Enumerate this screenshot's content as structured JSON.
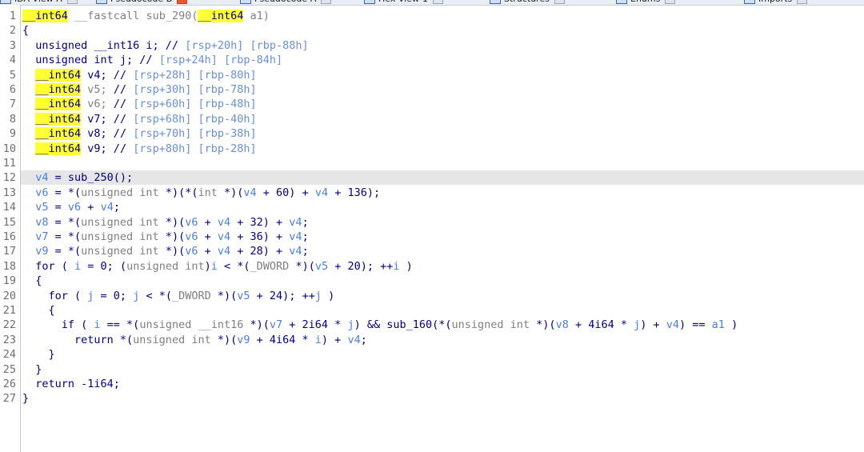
{
  "tabs": [
    {
      "label": "IDA View-A",
      "active": false
    },
    {
      "label": "Pseudocode-B",
      "active": true
    },
    {
      "label": "Pseudocode-A",
      "active": false
    },
    {
      "label": "Hex View-1",
      "active": false
    },
    {
      "label": "Structures",
      "active": false
    },
    {
      "label": "Enums",
      "active": false
    },
    {
      "label": "Imports",
      "active": false
    }
  ],
  "highlight_line": 12,
  "highlight_color": "#ffff33",
  "lines": [
    {
      "no": "1",
      "tokens": [
        [
          "h",
          "__int64"
        ],
        [
          "g",
          " __fastcall sub_290("
        ],
        [
          "h",
          "__int64"
        ],
        [
          "g",
          " a1)"
        ]
      ]
    },
    {
      "no": "2",
      "tokens": [
        [
          "n",
          "{"
        ]
      ]
    },
    {
      "no": "3",
      "tokens": [
        [
          "n",
          "  unsigned __int16 i; // "
        ],
        [
          "cv",
          "[rsp+20h] [rbp-88h]"
        ]
      ]
    },
    {
      "no": "4",
      "tokens": [
        [
          "n",
          "  unsigned int j; // "
        ],
        [
          "cv",
          "[rsp+24h] [rbp-84h]"
        ]
      ]
    },
    {
      "no": "5",
      "tokens": [
        [
          "n",
          "  "
        ],
        [
          "h",
          "__int64"
        ],
        [
          "n",
          " v4; // "
        ],
        [
          "cv",
          "[rsp+28h] [rbp-80h]"
        ]
      ]
    },
    {
      "no": "6",
      "tokens": [
        [
          "n",
          "  "
        ],
        [
          "h",
          "__int64"
        ],
        [
          "g",
          " v5; "
        ],
        [
          "n",
          "// "
        ],
        [
          "cv",
          "[rsp+30h] [rbp-78h]"
        ]
      ]
    },
    {
      "no": "7",
      "tokens": [
        [
          "n",
          "  "
        ],
        [
          "h",
          "__int64"
        ],
        [
          "g",
          " v6; "
        ],
        [
          "n",
          "// "
        ],
        [
          "cv",
          "[rsp+60h] [rbp-48h]"
        ]
      ]
    },
    {
      "no": "8",
      "tokens": [
        [
          "n",
          "  "
        ],
        [
          "h",
          "__int64"
        ],
        [
          "n",
          " v7; // "
        ],
        [
          "cv",
          "[rsp+68h] [rbp-40h]"
        ]
      ]
    },
    {
      "no": "9",
      "tokens": [
        [
          "n",
          "  "
        ],
        [
          "h",
          "__int64"
        ],
        [
          "n",
          " v8; // "
        ],
        [
          "cv",
          "[rsp+70h] [rbp-38h]"
        ]
      ]
    },
    {
      "no": "10",
      "tokens": [
        [
          "n",
          "  "
        ],
        [
          "h",
          "__int64"
        ],
        [
          "n",
          " v9; // "
        ],
        [
          "cv",
          "[rsp+80h] [rbp-28h]"
        ]
      ]
    },
    {
      "no": "11",
      "tokens": []
    },
    {
      "no": "12",
      "tokens": [
        [
          "v",
          "  v4"
        ],
        [
          "n",
          " = sub_250();"
        ]
      ]
    },
    {
      "no": "13",
      "tokens": [
        [
          "v",
          "  v6"
        ],
        [
          "n",
          " = *("
        ],
        [
          "g",
          "unsigned int"
        ],
        [
          "n",
          " *)(*("
        ],
        [
          "g",
          "int"
        ],
        [
          "n",
          " *)("
        ],
        [
          "v",
          "v4"
        ],
        [
          "n",
          " + 60) + "
        ],
        [
          "v",
          "v4"
        ],
        [
          "n",
          " + 136);"
        ]
      ]
    },
    {
      "no": "14",
      "tokens": [
        [
          "v",
          "  v5"
        ],
        [
          "n",
          " = "
        ],
        [
          "v",
          "v6"
        ],
        [
          "n",
          " + "
        ],
        [
          "v",
          "v4"
        ],
        [
          "n",
          ";"
        ]
      ]
    },
    {
      "no": "15",
      "tokens": [
        [
          "v",
          "  v8"
        ],
        [
          "n",
          " = *("
        ],
        [
          "g",
          "unsigned int"
        ],
        [
          "n",
          " *)("
        ],
        [
          "v",
          "v6"
        ],
        [
          "n",
          " + "
        ],
        [
          "v",
          "v4"
        ],
        [
          "n",
          " + 32) + "
        ],
        [
          "v",
          "v4"
        ],
        [
          "n",
          ";"
        ]
      ]
    },
    {
      "no": "16",
      "tokens": [
        [
          "v",
          "  v7"
        ],
        [
          "n",
          " = *("
        ],
        [
          "g",
          "unsigned int"
        ],
        [
          "n",
          " *)("
        ],
        [
          "v",
          "v6"
        ],
        [
          "n",
          " + "
        ],
        [
          "v",
          "v4"
        ],
        [
          "n",
          " + 36) + "
        ],
        [
          "v",
          "v4"
        ],
        [
          "n",
          ";"
        ]
      ]
    },
    {
      "no": "17",
      "tokens": [
        [
          "v",
          "  v9"
        ],
        [
          "n",
          " = *("
        ],
        [
          "g",
          "unsigned int"
        ],
        [
          "n",
          " *)("
        ],
        [
          "v",
          "v6"
        ],
        [
          "n",
          " + "
        ],
        [
          "v",
          "v4"
        ],
        [
          "n",
          " + 28) + "
        ],
        [
          "v",
          "v4"
        ],
        [
          "n",
          ";"
        ]
      ]
    },
    {
      "no": "18",
      "tokens": [
        [
          "n",
          "  for ( "
        ],
        [
          "v",
          "i"
        ],
        [
          "n",
          " = 0; ("
        ],
        [
          "g",
          "unsigned int"
        ],
        [
          "n",
          ")"
        ],
        [
          "v",
          "i"
        ],
        [
          "n",
          " < *("
        ],
        [
          "g",
          "_DWORD"
        ],
        [
          "n",
          " *)("
        ],
        [
          "v",
          "v5"
        ],
        [
          "n",
          " + 20); ++"
        ],
        [
          "v",
          "i"
        ],
        [
          "n",
          " )"
        ]
      ]
    },
    {
      "no": "19",
      "tokens": [
        [
          "n",
          "  {"
        ]
      ]
    },
    {
      "no": "20",
      "tokens": [
        [
          "n",
          "    for ( "
        ],
        [
          "v",
          "j"
        ],
        [
          "n",
          " = 0; "
        ],
        [
          "v",
          "j"
        ],
        [
          "n",
          " < *("
        ],
        [
          "g",
          "_DWORD"
        ],
        [
          "n",
          " *)("
        ],
        [
          "v",
          "v5"
        ],
        [
          "n",
          " + 24); ++"
        ],
        [
          "v",
          "j"
        ],
        [
          "n",
          " )"
        ]
      ]
    },
    {
      "no": "21",
      "tokens": [
        [
          "n",
          "    {"
        ]
      ]
    },
    {
      "no": "22",
      "tokens": [
        [
          "n",
          "      if ( "
        ],
        [
          "v",
          "i"
        ],
        [
          "n",
          " == *("
        ],
        [
          "g",
          "unsigned __int16"
        ],
        [
          "n",
          " *)("
        ],
        [
          "v",
          "v7"
        ],
        [
          "n",
          " + 2i64 * "
        ],
        [
          "v",
          "j"
        ],
        [
          "n",
          ") && sub_160(*("
        ],
        [
          "g",
          "unsigned int"
        ],
        [
          "n",
          " *)("
        ],
        [
          "v",
          "v8"
        ],
        [
          "n",
          " + 4i64 * "
        ],
        [
          "v",
          "j"
        ],
        [
          "n",
          ") + "
        ],
        [
          "v",
          "v4"
        ],
        [
          "n",
          ") == "
        ],
        [
          "v",
          "a1"
        ],
        [
          "n",
          " )"
        ]
      ]
    },
    {
      "no": "23",
      "tokens": [
        [
          "n",
          "        return *("
        ],
        [
          "g",
          "unsigned int"
        ],
        [
          "n",
          " *)("
        ],
        [
          "v",
          "v9"
        ],
        [
          "n",
          " + 4i64 * "
        ],
        [
          "v",
          "i"
        ],
        [
          "n",
          ") + "
        ],
        [
          "v",
          "v4"
        ],
        [
          "n",
          ";"
        ]
      ]
    },
    {
      "no": "24",
      "tokens": [
        [
          "n",
          "    }"
        ]
      ]
    },
    {
      "no": "25",
      "tokens": [
        [
          "n",
          "  }"
        ]
      ]
    },
    {
      "no": "26",
      "tokens": [
        [
          "n",
          "  return -1i64;"
        ]
      ]
    },
    {
      "no": "27",
      "tokens": [
        [
          "n",
          "}"
        ]
      ]
    }
  ]
}
